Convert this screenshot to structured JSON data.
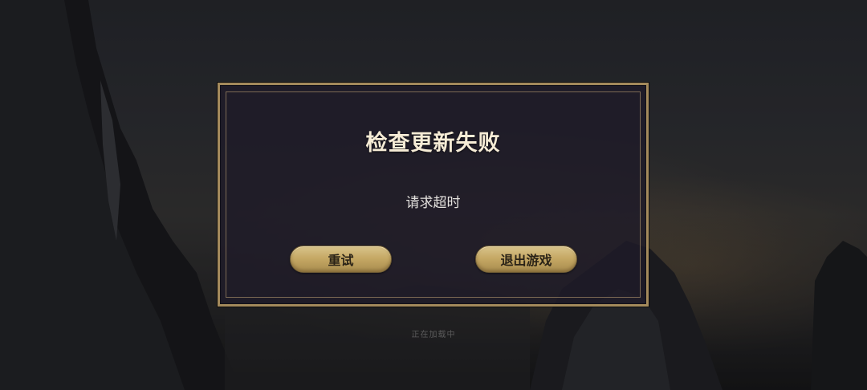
{
  "dialog": {
    "title": "检查更新失败",
    "message": "请求超时",
    "buttons": {
      "retry": "重试",
      "exit": "退出游戏"
    }
  },
  "background": {
    "loading_text": "正在加载中"
  },
  "colors": {
    "dialog_border": "#a48a5c",
    "button_gold": "#c6a965",
    "title_text": "#f6ecd6"
  }
}
